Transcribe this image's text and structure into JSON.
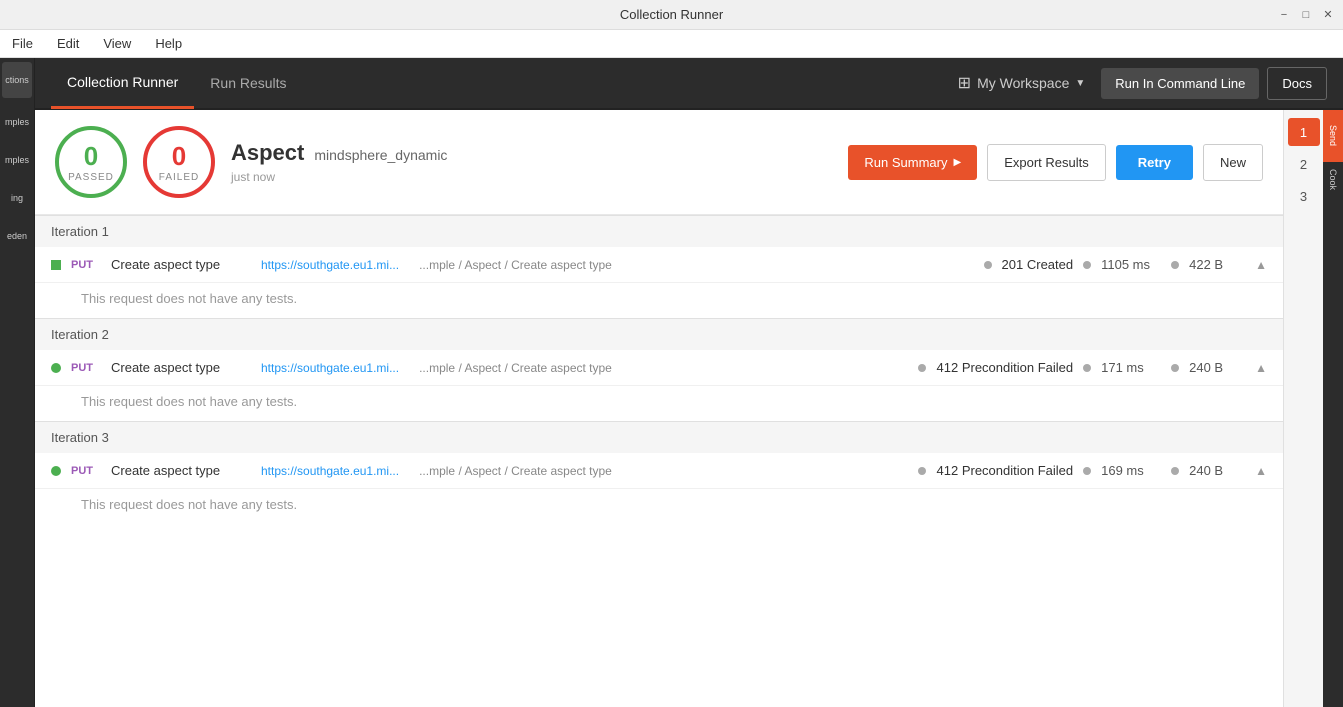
{
  "window": {
    "title": "Collection Runner"
  },
  "menu": {
    "items": [
      "File",
      "Edit",
      "View",
      "Help"
    ]
  },
  "topNav": {
    "tabs": [
      {
        "label": "Collection Runner",
        "active": true
      },
      {
        "label": "Run Results",
        "active": false
      }
    ],
    "workspace": {
      "label": "My Workspace",
      "icon": "⊞"
    },
    "actions": {
      "cmdLine": "Run In Command Line",
      "docs": "Docs"
    }
  },
  "runnerHeader": {
    "passed": {
      "count": "0",
      "label": "PASSED"
    },
    "failed": {
      "count": "0",
      "label": "FAILED"
    },
    "name": "Aspect",
    "collection": "mindsphere_dynamic",
    "time": "just now",
    "buttons": {
      "runSummary": "Run Summary",
      "exportResults": "Export Results",
      "retry": "Retry",
      "new": "New"
    }
  },
  "iterations": [
    {
      "label": "Iteration 1",
      "requests": [
        {
          "method": "PUT",
          "name": "Create aspect type",
          "url": "https://southgate.eu1.mi...",
          "path": "...mple / Aspect / Create aspect type",
          "statusCode": "201",
          "statusText": "Created",
          "time": "1105 ms",
          "size": "422 B",
          "noTests": "This request does not have any tests."
        }
      ]
    },
    {
      "label": "Iteration 2",
      "requests": [
        {
          "method": "PUT",
          "name": "Create aspect type",
          "url": "https://southgate.eu1.mi...",
          "path": "...mple / Aspect / Create aspect type",
          "statusCode": "412",
          "statusText": "Precondition Failed",
          "time": "171 ms",
          "size": "240 B",
          "noTests": "This request does not have any tests."
        }
      ]
    },
    {
      "label": "Iteration 3",
      "requests": [
        {
          "method": "PUT",
          "name": "Create aspect type",
          "url": "https://southgate.eu1.mi...",
          "path": "...mple / Aspect / Create aspect type",
          "statusCode": "412",
          "statusText": "Precondition Failed",
          "time": "169 ms",
          "size": "240 B",
          "noTests": "This request does not have any tests."
        }
      ]
    }
  ],
  "iterationNumbers": [
    "1",
    "2",
    "3"
  ],
  "sidebarItems": [
    {
      "label": "ctions",
      "active": false
    },
    {
      "label": "mples",
      "active": false
    },
    {
      "label": "mples",
      "active": false
    },
    {
      "label": "ing",
      "active": false
    },
    {
      "label": "eden",
      "active": false
    }
  ],
  "rightSidebar": {
    "labels": [
      "Send",
      "Cook"
    ]
  },
  "colors": {
    "accent": "#e8522a",
    "blue": "#2196F3",
    "green": "#4CAF50",
    "red": "#e53935",
    "darkBg": "#2c2c2c"
  }
}
